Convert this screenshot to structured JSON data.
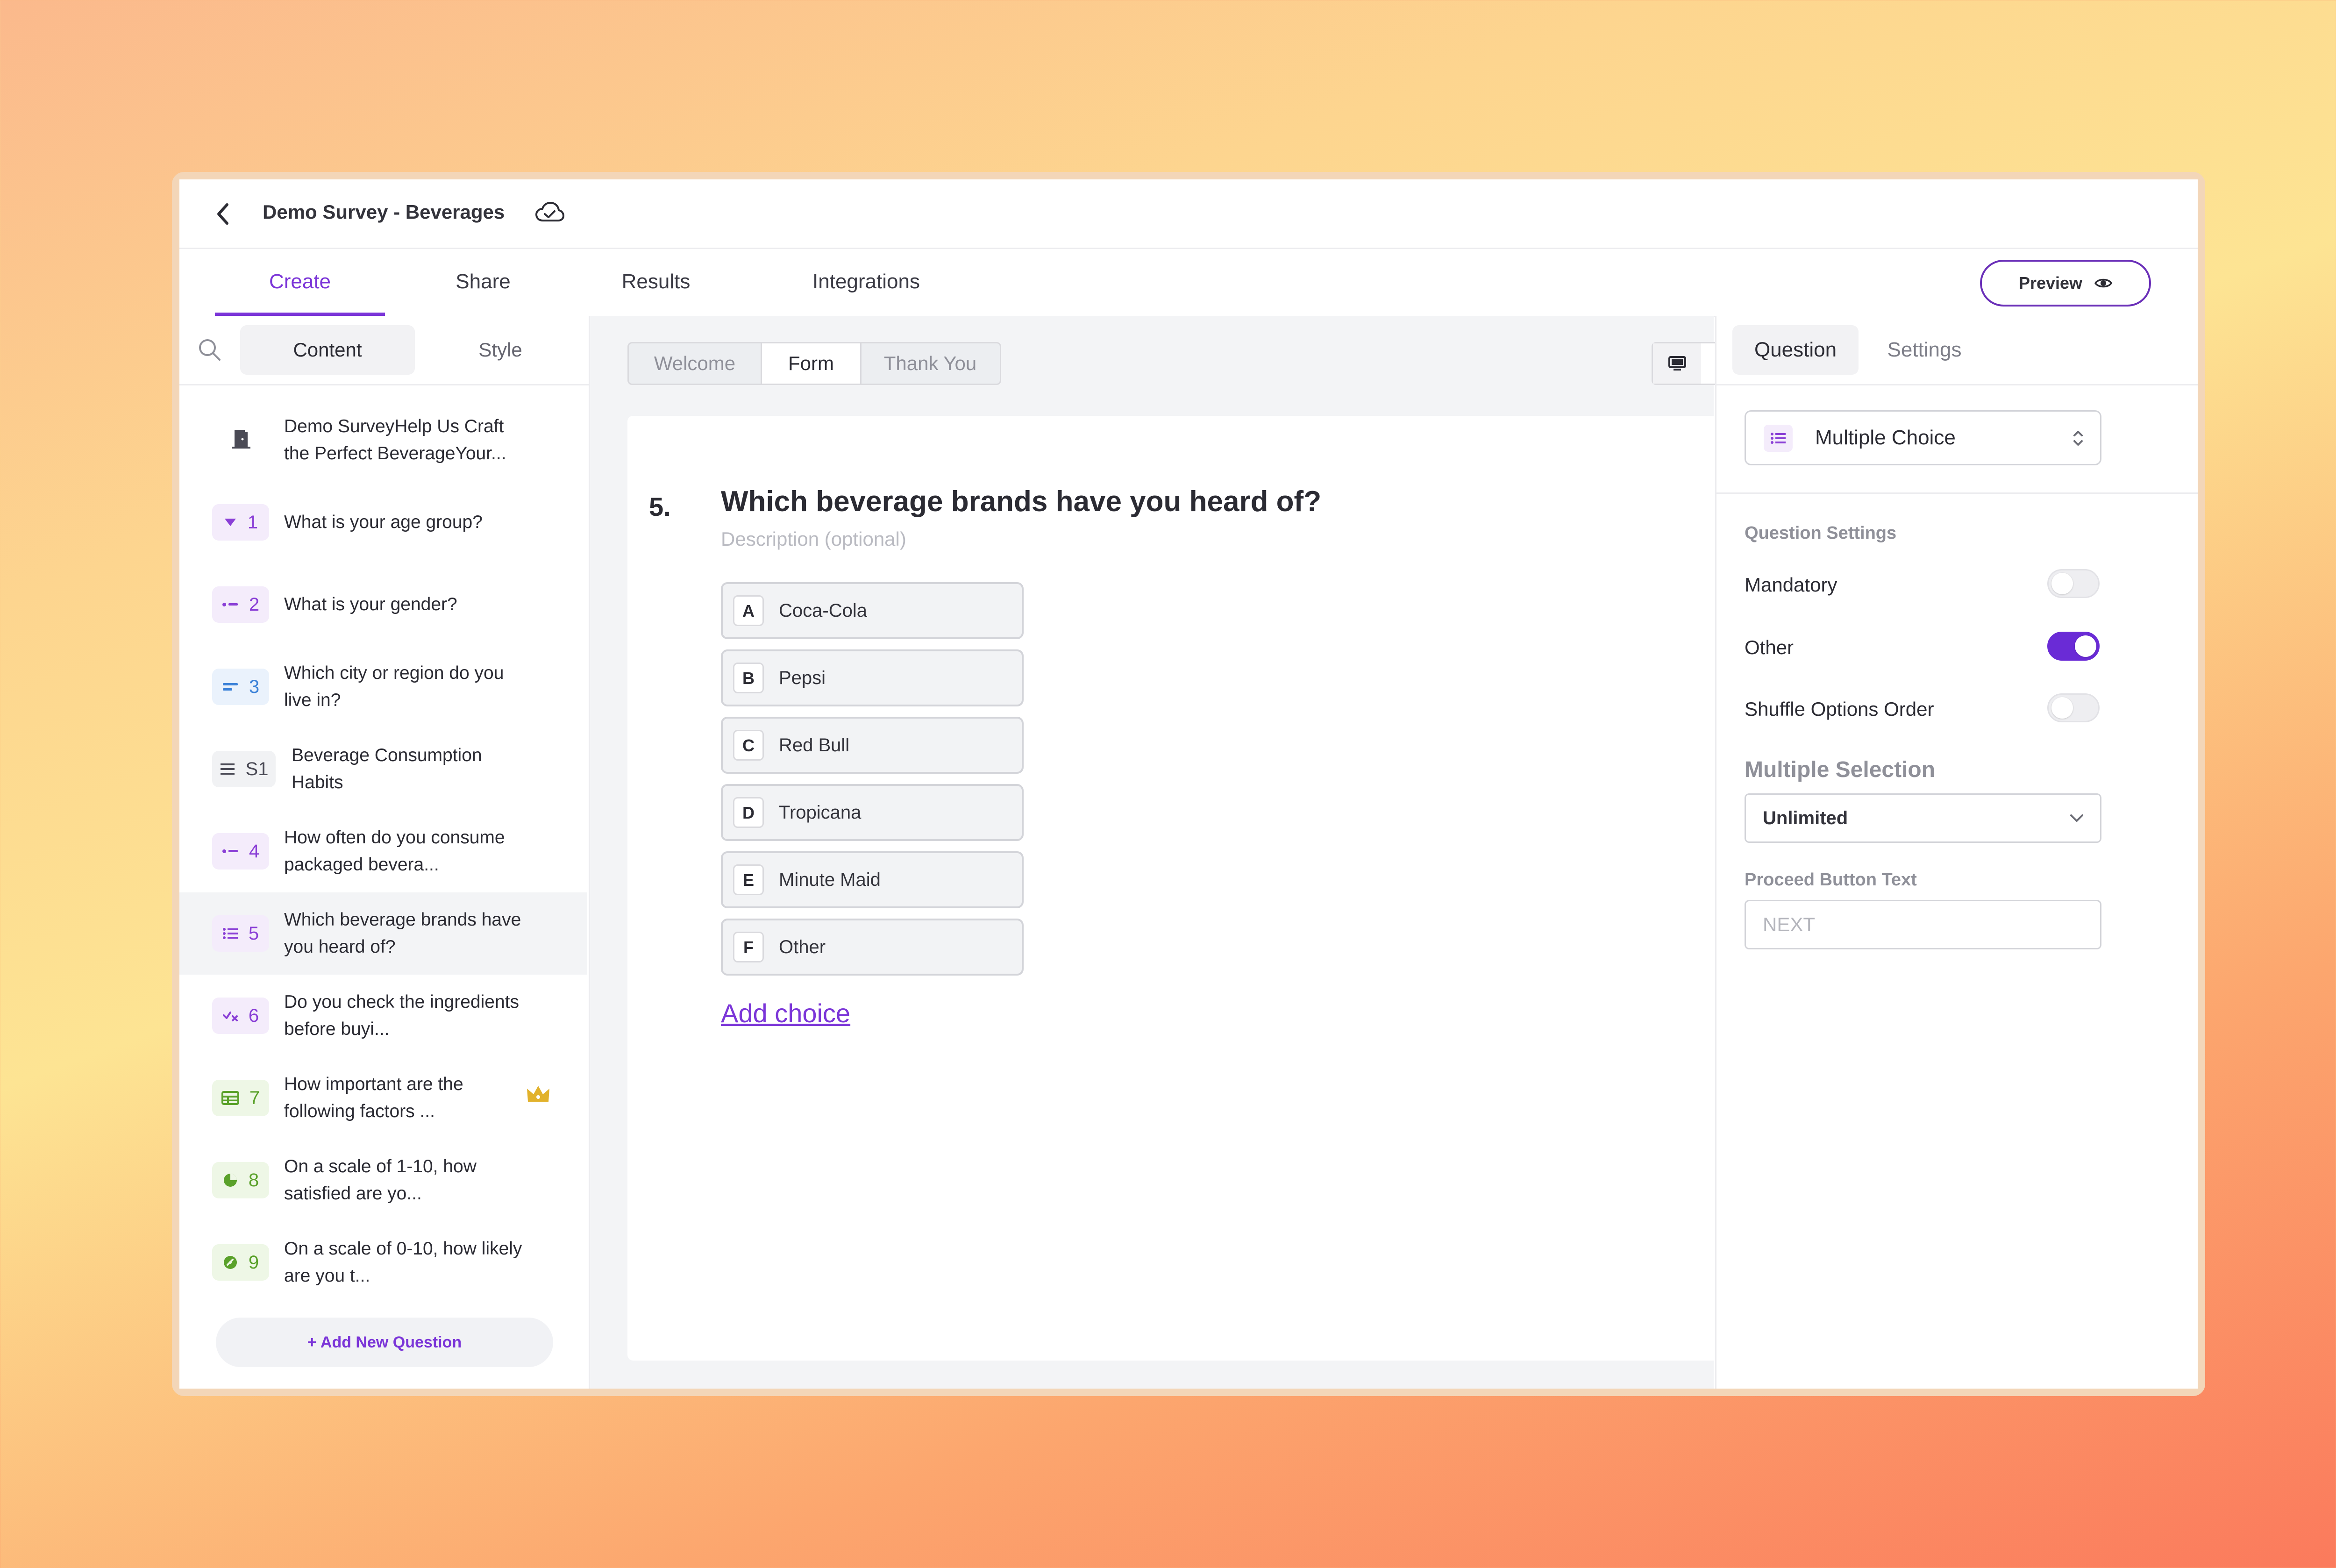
{
  "header": {
    "title": "Demo Survey - Beverages"
  },
  "tabs": [
    {
      "label": "Create",
      "active": true
    },
    {
      "label": "Share",
      "active": false
    },
    {
      "label": "Results",
      "active": false
    },
    {
      "label": "Integrations",
      "active": false
    }
  ],
  "preview_label": "Preview",
  "left_panel": {
    "content_tab": "Content",
    "style_tab": "Style",
    "items": [
      {
        "badge": "",
        "text": "Demo SurveyHelp Us Craft the Perfect BeverageYour...",
        "icon": "door-icon"
      },
      {
        "badge": "1",
        "text": "What is your age group?",
        "icon": "dropdown-caret-icon"
      },
      {
        "badge": "2",
        "text": "What is your gender?",
        "icon": "single-choice-icon"
      },
      {
        "badge": "3",
        "text": "Which city or region do you live in?",
        "icon": "short-text-icon"
      },
      {
        "badge": "S1",
        "text": "Beverage Consumption Habits",
        "icon": "section-icon"
      },
      {
        "badge": "4",
        "text": "How often do you consume packaged bevera...",
        "icon": "single-choice-icon"
      },
      {
        "badge": "5",
        "text": "Which beverage brands have you heard of?",
        "icon": "multiple-choice-icon",
        "selected": true
      },
      {
        "badge": "6",
        "text": "Do you check the ingredients before buyi...",
        "icon": "yes-no-icon"
      },
      {
        "badge": "7",
        "text": "How important are the following factors ...",
        "icon": "matrix-icon",
        "premium": true
      },
      {
        "badge": "8",
        "text": "On a scale of 1-10, how satisfied are yo...",
        "icon": "rating-icon"
      },
      {
        "badge": "9",
        "text": "On a scale of 0-10, how likely are you t...",
        "icon": "nps-icon"
      }
    ],
    "add_question": "+ Add New Question"
  },
  "view_tabs": [
    {
      "label": "Welcome",
      "active": false
    },
    {
      "label": "Form",
      "active": true
    },
    {
      "label": "Thank You",
      "active": false
    }
  ],
  "question": {
    "number": "5.",
    "title": "Which beverage brands have you heard of?",
    "description_placeholder": "Description (optional)",
    "choices": [
      {
        "letter": "A",
        "label": "Coca-Cola"
      },
      {
        "letter": "B",
        "label": "Pepsi"
      },
      {
        "letter": "C",
        "label": "Red Bull"
      },
      {
        "letter": "D",
        "label": "Tropicana"
      },
      {
        "letter": "E",
        "label": "Minute Maid"
      },
      {
        "letter": "F",
        "label": "Other"
      }
    ],
    "add_choice": "Add choice"
  },
  "right_panel": {
    "tab_question": "Question",
    "tab_settings": "Settings",
    "type": "Multiple Choice",
    "section_label": "Question Settings",
    "settings": [
      {
        "label": "Mandatory",
        "on": false
      },
      {
        "label": "Other",
        "on": true
      },
      {
        "label": "Shuffle Options Order",
        "on": false
      }
    ],
    "multiple_selection_label": "Multiple Selection",
    "multiple_selection_value": "Unlimited",
    "proceed_label": "Proceed Button Text",
    "proceed_placeholder": "NEXT"
  },
  "colors": {
    "accent": "#7b35d8",
    "badge_purple_bg": "#f4ecfb",
    "badge_blue_bg": "#eaf2fc",
    "badge_green_bg": "#eef7e6",
    "premium": "#e2b22c"
  }
}
